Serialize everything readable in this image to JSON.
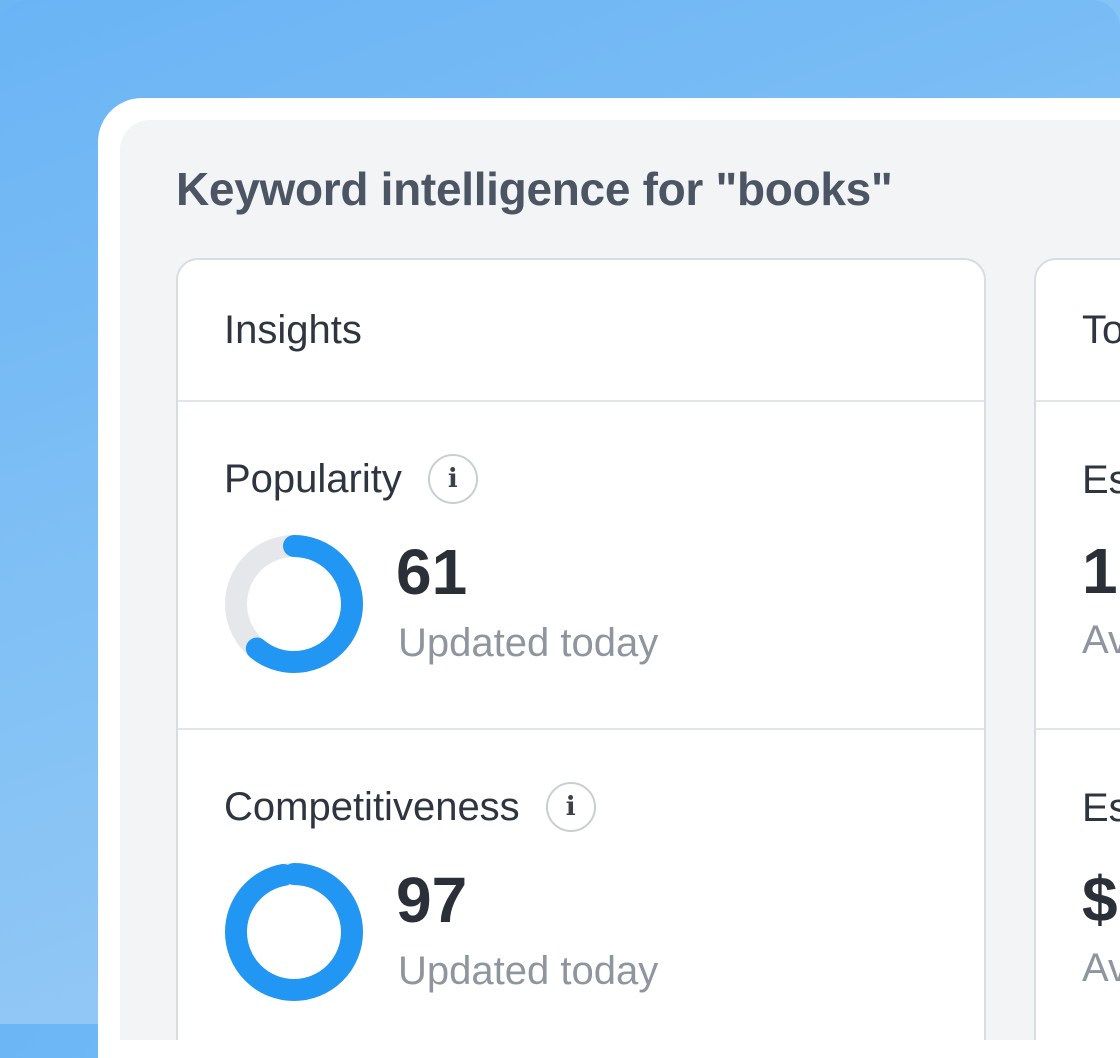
{
  "page": {
    "title": "Keyword intelligence for \"books\""
  },
  "insights": {
    "header": "Insights",
    "metrics": [
      {
        "label": "Popularity",
        "info_icon": "info-icon",
        "value": "61",
        "value_fraction": 0.61,
        "subtext": "Updated today"
      },
      {
        "label": "Competitiveness",
        "info_icon": "info-icon",
        "value": "97",
        "value_fraction": 0.97,
        "subtext": "Updated today"
      }
    ]
  },
  "right_card": {
    "header": "To",
    "metrics": [
      {
        "label": "Es",
        "value": "1",
        "subtext": "Av"
      },
      {
        "label": "Es",
        "value": "$",
        "subtext": "Av"
      }
    ]
  },
  "colors": {
    "accent": "#2196f3",
    "track": "#e5e7eb",
    "background_gradient_start": "#6ab4f5",
    "background_gradient_end": "#9fcdf6",
    "panel": "#f3f4f6"
  }
}
